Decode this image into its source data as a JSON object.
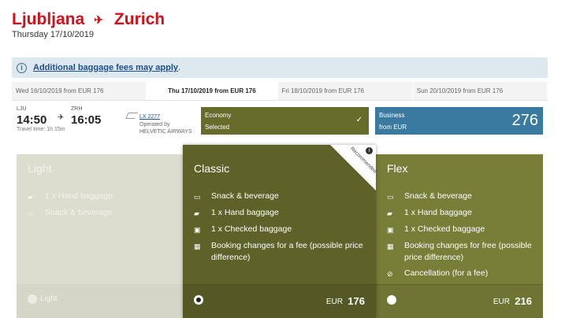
{
  "header": {
    "origin": "Ljubljana",
    "destination": "Zurich",
    "date": "Thursday 17/10/2019"
  },
  "notice": {
    "link": "Additional baggage fees may apply",
    "suffix": "."
  },
  "dates": [
    {
      "label": "Wed 16/10/2019 from EUR  176",
      "active": false
    },
    {
      "label": "Thu 17/10/2019 from EUR  176",
      "active": true
    },
    {
      "label": "Fri 18/10/2019 from EUR  176",
      "active": false
    },
    {
      "label": "Sun 20/10/2019 from EUR  176",
      "active": false
    }
  ],
  "flight": {
    "dep_code": "LJU",
    "dep_time": "14:50",
    "arr_code": "ZRH",
    "arr_time": "16:05",
    "travel_time": "Travel time: 1h 15m",
    "flight_number": "LX 2277",
    "operated_by": "Operated by",
    "operator": "HELVETIC AIRWAYS"
  },
  "cabins": {
    "economy": {
      "label": "Economy",
      "status": "Selected"
    },
    "business": {
      "label": "Business",
      "from": "from EUR",
      "price": "276"
    }
  },
  "fares": {
    "light": {
      "name": "Light",
      "features": [
        {
          "icon": "hand-baggage-icon",
          "text": "1 x Hand baggage"
        },
        {
          "icon": "snack-icon",
          "text": "Snack & beverage"
        }
      ],
      "footer_label": "Light"
    },
    "classic": {
      "name": "Classic",
      "badge": "Recommended",
      "features": [
        {
          "icon": "snack-icon",
          "text": "Snack & beverage"
        },
        {
          "icon": "hand-baggage-icon",
          "text": "1 x Hand baggage"
        },
        {
          "icon": "checked-baggage-icon",
          "text": "1 x Checked baggage"
        },
        {
          "icon": "calendar-icon",
          "text": "Booking changes for a fee (possible price difference)"
        }
      ],
      "currency": "EUR",
      "price": "176"
    },
    "flex": {
      "name": "Flex",
      "features": [
        {
          "icon": "snack-icon",
          "text": "Snack & beverage"
        },
        {
          "icon": "hand-baggage-icon",
          "text": "1 x Hand baggage"
        },
        {
          "icon": "checked-baggage-icon",
          "text": "1 x Checked baggage"
        },
        {
          "icon": "calendar-icon",
          "text": "Booking changes for free (possible price difference)"
        },
        {
          "icon": "cancellation-icon",
          "text": "Cancellation (for a fee)"
        }
      ],
      "currency": "EUR",
      "price": "216"
    }
  }
}
